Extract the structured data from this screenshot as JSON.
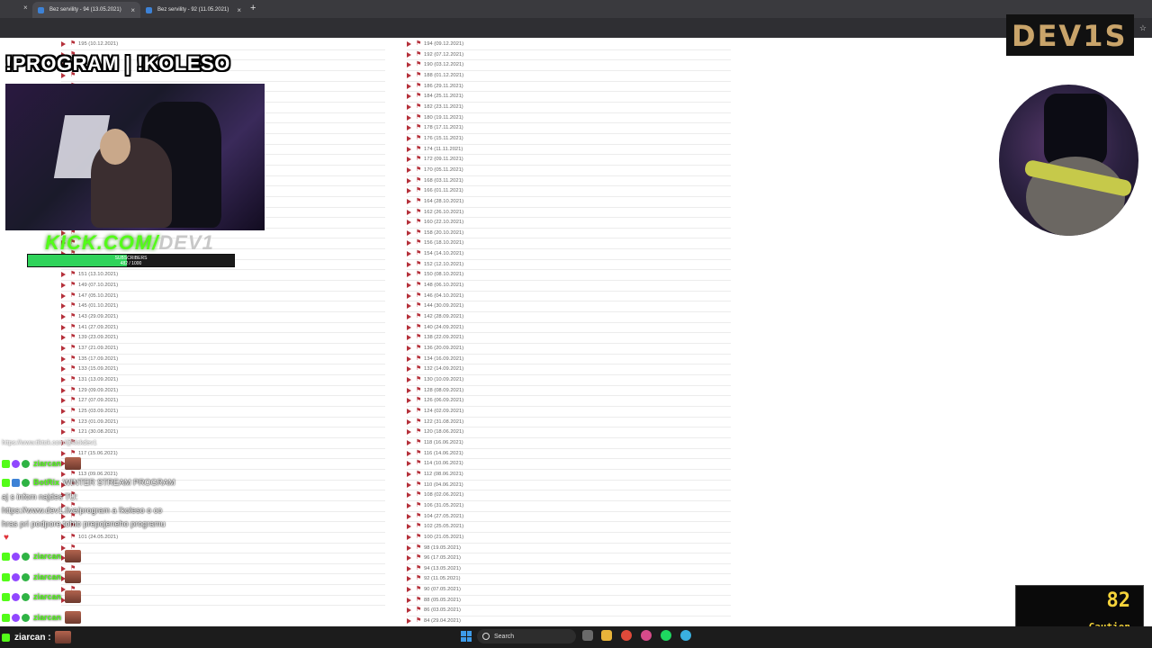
{
  "tabs": [
    {
      "label": "Bez servility - 94 (13.05.2021)"
    },
    {
      "label": "Bez servility - 92 (11.05.2021)"
    }
  ],
  "left_list": [
    "195 (10.12.2021)",
    "",
    "",
    "",
    "",
    "",
    "",
    "",
    "",
    "",
    "",
    "",
    "",
    "",
    "",
    "",
    "",
    "",
    "",
    "",
    "",
    "",
    "151 (13.10.2021)",
    "149 (07.10.2021)",
    "147 (05.10.2021)",
    "145 (01.10.2021)",
    "143 (29.09.2021)",
    "141 (27.09.2021)",
    "139 (23.09.2021)",
    "137 (21.09.2021)",
    "135 (17.09.2021)",
    "133 (15.09.2021)",
    "131 (13.09.2021)",
    "129 (09.09.2021)",
    "127 (07.09.2021)",
    "125 (03.09.2021)",
    "123 (01.09.2021)",
    "121 (30.08.2021)",
    "",
    "117 (15.06.2021)",
    "",
    "113 (09.06.2021)",
    "",
    "",
    "",
    "",
    "",
    "101 (24.05.2021)",
    "",
    "",
    "",
    "",
    "",
    ""
  ],
  "right_list": [
    "194 (09.12.2021)",
    "192 (07.12.2021)",
    "190 (03.12.2021)",
    "188 (01.12.2021)",
    "186 (29.11.2021)",
    "184 (25.11.2021)",
    "182 (23.11.2021)",
    "180 (19.11.2021)",
    "178 (17.11.2021)",
    "176 (15.11.2021)",
    "174 (11.11.2021)",
    "172 (09.11.2021)",
    "170 (05.11.2021)",
    "168 (03.11.2021)",
    "166 (01.11.2021)",
    "164 (28.10.2021)",
    "162 (26.10.2021)",
    "160 (22.10.2021)",
    "158 (20.10.2021)",
    "156 (18.10.2021)",
    "154 (14.10.2021)",
    "152 (12.10.2021)",
    "150 (08.10.2021)",
    "148 (06.10.2021)",
    "146 (04.10.2021)",
    "144 (30.09.2021)",
    "142 (28.09.2021)",
    "140 (24.09.2021)",
    "138 (22.09.2021)",
    "136 (20.09.2021)",
    "134 (16.09.2021)",
    "132 (14.09.2021)",
    "130 (10.09.2021)",
    "128 (08.09.2021)",
    "126 (06.09.2021)",
    "124 (02.09.2021)",
    "122 (31.08.2021)",
    "120 (18.06.2021)",
    "118 (16.06.2021)",
    "116 (14.06.2021)",
    "114 (10.06.2021)",
    "112 (08.06.2021)",
    "110 (04.06.2021)",
    "108 (02.06.2021)",
    "106 (31.05.2021)",
    "104 (27.05.2021)",
    "102 (25.05.2021)",
    "100 (21.05.2021)",
    "98 (19.05.2021)",
    "96 (17.05.2021)",
    "94 (13.05.2021)",
    "92 (11.05.2021)",
    "90 (07.05.2021)",
    "88 (05.05.2021)",
    "86 (03.05.2021)",
    "84 (29.04.2021)"
  ],
  "overlay": {
    "title": "!PROGRAM | !KOLESO",
    "kick_a": "KICK.COM/",
    "kick_b": "DEV1",
    "sub_label": "SUBSCRIBERS",
    "sub_count": "482 / 1000",
    "sub_fraction": 0.482,
    "ghost1": "https://www.tiktok.com/@kickdev1",
    "logo": "DEV1S",
    "gauge_value": "82",
    "gauge_caption": "Caution"
  },
  "chat": [
    {
      "user": "ziarcan",
      "emote": true,
      "text": ""
    },
    {
      "user": "BotRix",
      "emote": false,
      "text": "WINTER STREAM PROGRAM"
    },
    {
      "user": "",
      "emote": false,
      "text": "aj s infom najdes TU:"
    },
    {
      "user": "",
      "emote": false,
      "text": "https://www.dev1.live/program a !koleso o co"
    },
    {
      "user": "",
      "emote": false,
      "text": "hras pri podpore tohto prepojeneho programu"
    },
    {
      "user": "ziarcan",
      "emote": true,
      "text": ""
    },
    {
      "user": "ziarcan",
      "emote": true,
      "text": ""
    },
    {
      "user": "ziarcan",
      "emote": true,
      "text": ""
    },
    {
      "user": "ziarcan",
      "emote": true,
      "text": ""
    }
  ],
  "chat_bottom_user": "ziarcan :",
  "taskbar": {
    "search": "Search"
  },
  "colors": {
    "kick_green": "#53fc18",
    "accent_red": "#b5303a",
    "gauge_yellow": "#f5d33a"
  }
}
